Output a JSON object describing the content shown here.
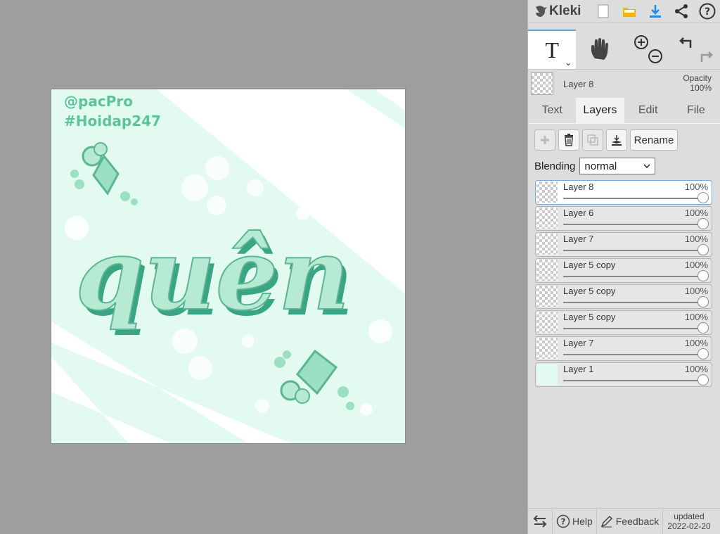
{
  "app": {
    "name": "Kleki"
  },
  "toolbar": {
    "tool_glyph": "T",
    "caret": "⌄"
  },
  "current_layer": {
    "name": "Layer 8",
    "opacity_label": "Opacity",
    "opacity_value": "100%"
  },
  "tabs": [
    {
      "label": "Text",
      "active": false
    },
    {
      "label": "Layers",
      "active": true
    },
    {
      "label": "Edit",
      "active": false
    },
    {
      "label": "File",
      "active": false
    }
  ],
  "layer_panel": {
    "rename_label": "Rename",
    "blending_label": "Blending",
    "blending_value": "normal",
    "layers": [
      {
        "name": "Layer 8",
        "opacity": "100%",
        "active": true
      },
      {
        "name": "Layer 6",
        "opacity": "100%",
        "active": false
      },
      {
        "name": "Layer 7",
        "opacity": "100%",
        "active": false
      },
      {
        "name": "Layer 5 copy",
        "opacity": "100%",
        "active": false
      },
      {
        "name": "Layer 5 copy",
        "opacity": "100%",
        "active": false
      },
      {
        "name": "Layer 5 copy",
        "opacity": "100%",
        "active": false
      },
      {
        "name": "Layer 7",
        "opacity": "100%",
        "active": false
      },
      {
        "name": "Layer 1",
        "opacity": "100%",
        "active": false
      }
    ]
  },
  "canvas": {
    "text_handle": "@pacPro",
    "text_hashtag": "#Hoidap247",
    "text_word": "quên"
  },
  "bottom": {
    "help_label": "Help",
    "feedback_label": "Feedback",
    "updated_label": "updated",
    "updated_date": "2022-02-20"
  },
  "colors": {
    "mint": "#b6ead3",
    "mint_dark": "#5bb595",
    "accent": "#1e88e5"
  }
}
